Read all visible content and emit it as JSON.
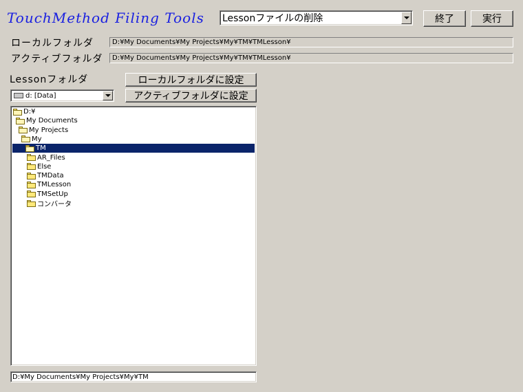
{
  "app_title": "TouchMethod Filing Tools",
  "action_combo": {
    "value": "Lessonファイルの削除"
  },
  "buttons": {
    "exit": "終了",
    "run": "実行",
    "set_local": "ローカルフォルダに設定",
    "set_active": "アクティブフォルダに設定"
  },
  "local_folder": {
    "label": "ローカルフォルダ",
    "value": "D:¥My Documents¥My Projects¥My¥TM¥TMLesson¥"
  },
  "active_folder": {
    "label": "アクティブフォルダ",
    "value": "D:¥My Documents¥My Projects¥My¥TM¥TMLesson¥"
  },
  "lesson_folder": {
    "label": "Lessonフォルダ"
  },
  "drive_combo": {
    "value": "d: [Data]",
    "icon": "drive-icon"
  },
  "tree": [
    {
      "label": "D:¥",
      "icon": "open-folder-icon",
      "selected": false
    },
    {
      "label": "My Documents",
      "icon": "open-folder-icon",
      "selected": false
    },
    {
      "label": "My Projects",
      "icon": "open-folder-icon",
      "selected": false
    },
    {
      "label": "My",
      "icon": "open-folder-icon",
      "selected": false
    },
    {
      "label": "TM",
      "icon": "open-folder-icon",
      "selected": true
    },
    {
      "label": "AR_Files",
      "icon": "folder-icon",
      "selected": false
    },
    {
      "label": "Else",
      "icon": "folder-icon",
      "selected": false
    },
    {
      "label": "TMData",
      "icon": "folder-icon",
      "selected": false
    },
    {
      "label": "TMLesson",
      "icon": "folder-icon",
      "selected": false
    },
    {
      "label": "TMSetUp",
      "icon": "folder-icon",
      "selected": false
    },
    {
      "label": "コンバータ",
      "icon": "folder-icon",
      "selected": false
    }
  ],
  "current_path": "D:¥My Documents¥My Projects¥My¥TM",
  "colors": {
    "title": "#1a20e0",
    "background": "#d4d0c8",
    "selection": "#0a246a"
  }
}
